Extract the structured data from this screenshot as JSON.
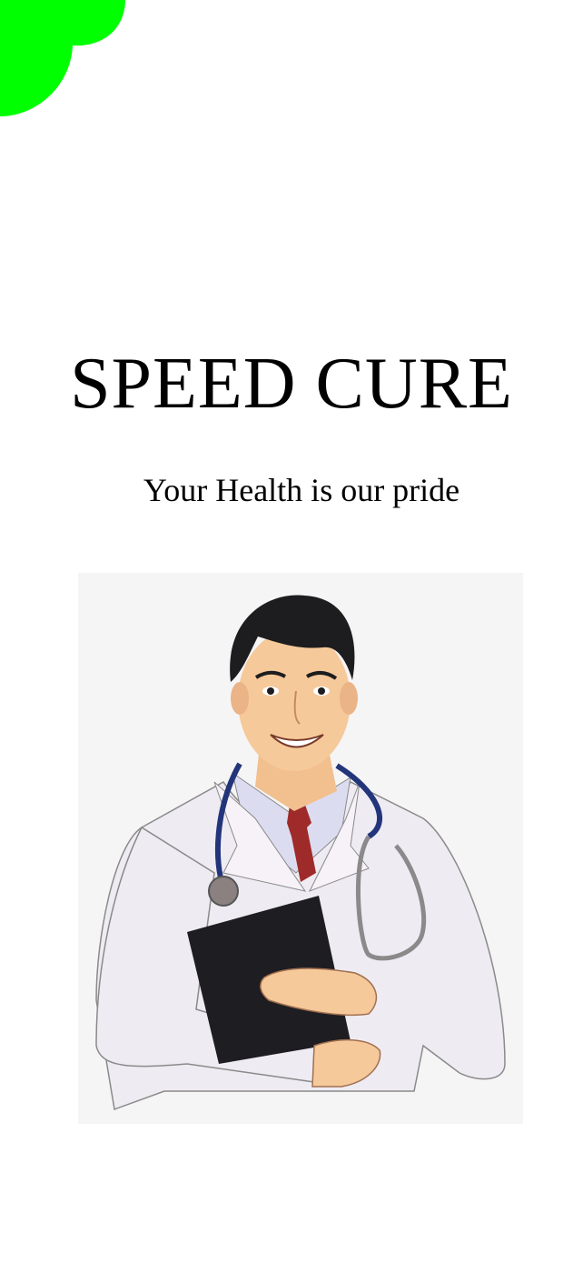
{
  "app": {
    "title": "SPEED CURE",
    "tagline": "Your Health is our pride"
  },
  "colors": {
    "background": "#ffffff",
    "accent_green": "#00ff00",
    "illustration_bg": "#f5f5f5"
  },
  "icons": {
    "corner_decoration": "green-blob-decoration",
    "hero_image": "doctor-illustration"
  }
}
